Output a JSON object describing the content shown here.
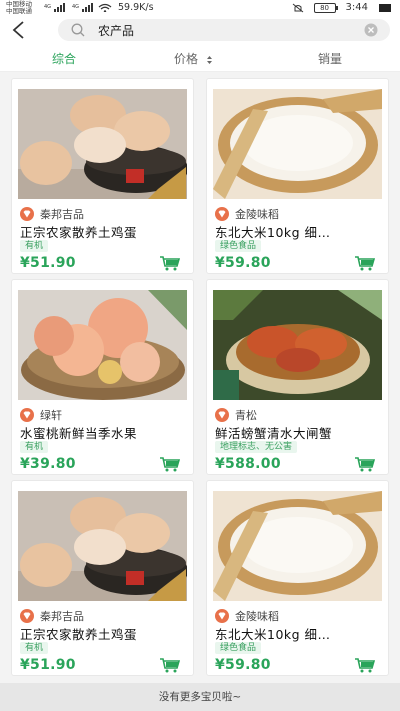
{
  "status_bar": {
    "carrier1": "中国移动",
    "carrier2": "中国联通",
    "net1": "4G",
    "net2": "4G",
    "speed": "59.9K/s",
    "battery": "80",
    "time": "3:44"
  },
  "search": {
    "value": "农产品",
    "placeholder": ""
  },
  "sort_tabs": [
    {
      "label": "综合",
      "active": true
    },
    {
      "label": "价格",
      "active": false
    },
    {
      "label": "销量",
      "active": false
    }
  ],
  "products": [
    {
      "image": "eggs",
      "store": "秦邦吉品",
      "name": "正宗农家散养土鸡蛋",
      "tag": "有机",
      "price": "¥51.90"
    },
    {
      "image": "rice",
      "store": "金陵味稻",
      "name": "东北大米10kg  细…",
      "tag": "绿色食品",
      "price": "¥59.80"
    },
    {
      "image": "peaches",
      "store": "绿轩",
      "name": "水蜜桃新鲜当季水果",
      "tag": "有机",
      "price": "¥39.80"
    },
    {
      "image": "crabs",
      "store": "青松",
      "name": "鲜活螃蟹清水大闸蟹",
      "tag": "地理标志、无公害",
      "price": "¥588.00"
    },
    {
      "image": "eggs",
      "store": "秦邦吉品",
      "name": "正宗农家散养土鸡蛋",
      "tag": "有机",
      "price": "¥51.90"
    },
    {
      "image": "rice",
      "store": "金陵味稻",
      "name": "东北大米10kg  细…",
      "tag": "绿色食品",
      "price": "¥59.80"
    }
  ],
  "footer_note": "没有更多宝贝啦~",
  "colors": {
    "accent": "#29a35a",
    "store_icon": "#e8714a"
  }
}
